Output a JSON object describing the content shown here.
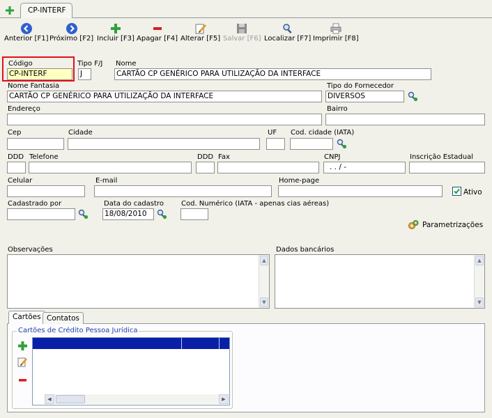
{
  "window": {
    "tab_label": "CP-INTERF"
  },
  "toolbar": {
    "anterior": "Anterior [F1]",
    "proximo": "Próximo [F2]",
    "incluir": "Incluir [F3]",
    "apagar": "Apagar [F4]",
    "alterar": "Alterar [F5]",
    "salvar": "Salvar [F6]",
    "localizar": "Localizar [F7]",
    "imprimir": "Imprimir [F8]"
  },
  "form": {
    "codigo_label": "Código",
    "codigo_value": "CP-INTERF",
    "tipo_label": "Tipo F/J",
    "tipo_value": "J",
    "nome_label": "Nome",
    "nome_value": "CARTÃO CP GENÉRICO PARA UTILIZAÇÃO DA INTERFACE",
    "fantasia_label": "Nome Fantasia",
    "fantasia_value": "CARTÃO CP GENÉRICO PARA UTILIZAÇÃO DA INTERFACE",
    "tipo_fornecedor_label": "Tipo do Fornecedor",
    "tipo_fornecedor_value": "DIVERSOS",
    "endereco_label": "Endereço",
    "bairro_label": "Bairro",
    "cep_label": "Cep",
    "cidade_label": "Cidade",
    "uf_label": "UF",
    "cod_cidade_label": "Cod. cidade (IATA)",
    "ddd1_label": "DDD",
    "telefone_label": "Telefone",
    "ddd2_label": "DDD",
    "fax_label": "Fax",
    "cnpj_label": "CNPJ",
    "cnpj_value": " .  .  /  -",
    "inscricao_label": "Inscrição Estadual",
    "celular_label": "Celular",
    "email_label": "E-mail",
    "homepage_label": "Home-page",
    "ativo_label": "Ativo",
    "cadastrado_label": "Cadastrado por",
    "data_cadastro_label": "Data do cadastro",
    "data_cadastro_value": "18/08/2010",
    "cod_numerico_label": "Cod. Numérico (IATA - apenas cias aéreas)",
    "parametrizacoes": "Parametrizações",
    "observacoes_label": "Observações",
    "dados_bancarios_label": "Dados bancários"
  },
  "tabs": {
    "cartoes": "Cartões",
    "contatos": "Contatos"
  },
  "cards_group": {
    "title": "Cartões de Crédito Pessoa Jurídica"
  },
  "colors": {
    "accent_blue": "#0a1fa8",
    "highlight_red": "#e0101a",
    "field_yellow": "#ffffc0"
  }
}
